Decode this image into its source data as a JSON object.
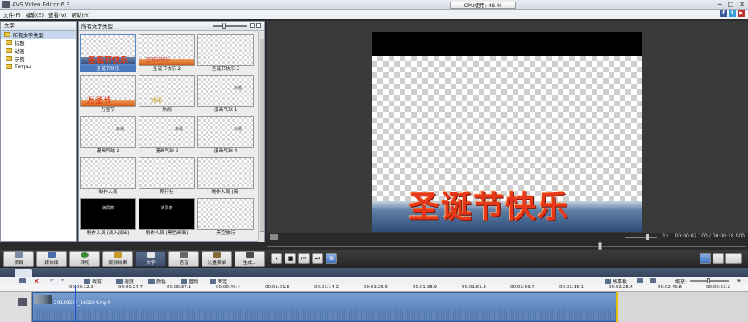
{
  "window": {
    "title": "AVS Video Editor 6.3",
    "cpu": "CPU使用: 46 %"
  },
  "menu": [
    "文件(F)",
    "编辑(E)",
    "查看(V)",
    "帮助(H)"
  ],
  "social": [
    "f",
    "t",
    "▶"
  ],
  "left_panel": {
    "header": "文字",
    "items": [
      {
        "label": "所有文字类型",
        "selected": true
      },
      {
        "label": "标题",
        "selected": false
      },
      {
        "label": "动画",
        "selected": false
      },
      {
        "label": "示例",
        "selected": false
      },
      {
        "label": "Титры",
        "selected": false
      }
    ]
  },
  "middle_panel": {
    "header": "所有文字类型",
    "thumbs": [
      {
        "caption": "圣诞节快乐",
        "selected": true,
        "style": "christmas",
        "deco": "圣诞节快乐"
      },
      {
        "caption": "圣诞节快乐 2",
        "selected": false,
        "style": "christmas2",
        "deco": "圣诞节快乐"
      },
      {
        "caption": "圣诞节快乐 3",
        "selected": false,
        "style": "plain",
        "deco": ""
      },
      {
        "caption": "万圣节",
        "selected": false,
        "style": "halloween",
        "deco": "万圣节"
      },
      {
        "caption": "热闹",
        "selected": false,
        "style": "lively",
        "deco": "热闹"
      },
      {
        "caption": "漫画气球 1",
        "selected": false,
        "style": "balloon",
        "deco": "标题"
      },
      {
        "caption": "漫画气球 2",
        "selected": false,
        "style": "balloon",
        "deco": "标题"
      },
      {
        "caption": "漫画气球 3",
        "selected": false,
        "style": "balloon",
        "deco": "标题"
      },
      {
        "caption": "漫画气球 4",
        "selected": false,
        "style": "balloon",
        "deco": "标题"
      },
      {
        "caption": "制作人员",
        "selected": false,
        "style": "plain",
        "deco": ""
      },
      {
        "caption": "爬行社",
        "selected": false,
        "style": "plain",
        "deco": ""
      },
      {
        "caption": "制作人员 (简)",
        "selected": false,
        "style": "plain",
        "deco": ""
      },
      {
        "caption": "制作人员 (淡入淡出)",
        "selected": false,
        "style": "black",
        "deco": "演员表"
      },
      {
        "caption": "制作人员 (黑色画面)",
        "selected": false,
        "style": "black",
        "deco": "演员表"
      },
      {
        "caption": "天空旅行",
        "selected": false,
        "style": "plain",
        "deco": ""
      }
    ]
  },
  "preview": {
    "title_text": "圣诞节快乐",
    "zoom": "1x",
    "time": "00:00:02.100 / 00:00:18.900"
  },
  "toolbar": {
    "buttons": [
      {
        "label": "项目",
        "name": "project-button"
      },
      {
        "label": "媒体库",
        "name": "media-library-button"
      },
      {
        "label": "转场",
        "name": "transitions-button"
      },
      {
        "label": "视频效果",
        "name": "video-effects-button"
      },
      {
        "label": "文字",
        "name": "text-button",
        "active": true
      },
      {
        "label": "语音",
        "name": "voice-button"
      },
      {
        "label": "光盘菜单",
        "name": "disc-menu-button"
      },
      {
        "label": "生成...",
        "name": "produce-button"
      }
    ],
    "playback": [
      "⏸",
      "■",
      "⏮",
      "⏭",
      "⧉"
    ]
  },
  "timeline": {
    "tools": [
      "裁剪",
      "速度",
      "颜色",
      "音频",
      "图定"
    ],
    "storyboard_label": "故事板",
    "zoom_label": "缩放:",
    "ruler": [
      "00:00:12.3",
      "00:00:24.7",
      "00:00:37.1",
      "00:00:49.4",
      "00:01:01.8",
      "00:01:14.2",
      "00:01:26.6",
      "00:01:38.9",
      "00:01:51.3",
      "00:02:03.7",
      "00:02:16.1",
      "00:02:28.4",
      "00:02:40.8",
      "00:02:53.2"
    ],
    "clip_name": "20130214_160224.mp4"
  }
}
